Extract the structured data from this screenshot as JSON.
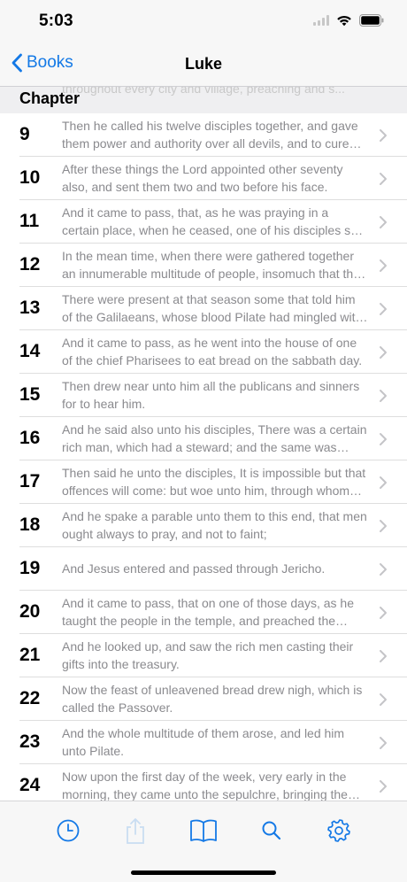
{
  "status_bar": {
    "time": "5:03"
  },
  "nav": {
    "back_label": "Books",
    "title": "Luke"
  },
  "section": {
    "header": "Chapter",
    "partial_text": "throughout every city and village, preaching and s..."
  },
  "colors": {
    "accent": "#1479e6",
    "subtitle": "#8a8a8e",
    "chevron": "#c4c4c7"
  },
  "chapters": [
    {
      "num": "9",
      "text": "Then he called his twelve disciples together, and gave them power and authority over all devils, and to cure diseases."
    },
    {
      "num": "10",
      "text": "After these things the Lord appointed other seventy also, and sent them two and two before his face."
    },
    {
      "num": "11",
      "text": "And it came to pass, that, as he was praying in a certain place, when he ceased, one of his disciples said unto him."
    },
    {
      "num": "12",
      "text": "In the mean time, when there were gathered together an innumerable multitude of people, insomuch that they trode one upon another."
    },
    {
      "num": "13",
      "text": "There were present at that season some that told him of the Galilaeans, whose blood Pilate had mingled with their sacrifices."
    },
    {
      "num": "14",
      "text": "And it came to pass, as he went into the house of one of the chief Pharisees to eat bread on the sabbath day."
    },
    {
      "num": "15",
      "text": "Then drew near unto him all the publicans and sinners for to hear him."
    },
    {
      "num": "16",
      "text": "And he said also unto his disciples, There was a certain rich man, which had a steward; and the same was accused."
    },
    {
      "num": "17",
      "text": "Then said he unto the disciples, It is impossible but that offences will come: but woe unto him, through whom they come!"
    },
    {
      "num": "18",
      "text": "And he spake a parable unto them to this end, that men ought always to pray, and not to faint;"
    },
    {
      "num": "19",
      "text": "And Jesus entered and passed through Jericho."
    },
    {
      "num": "20",
      "text": "And it came to pass, that on one of those days, as he taught the people in the temple, and preached the gospel."
    },
    {
      "num": "21",
      "text": "And he looked up, and saw the rich men casting their gifts into the treasury."
    },
    {
      "num": "22",
      "text": "Now the feast of unleavened bread drew nigh, which is called the Passover."
    },
    {
      "num": "23",
      "text": "And the whole multitude of them arose, and led him unto Pilate."
    },
    {
      "num": "24",
      "text": "Now upon the first day of the week, very early in the morning, they came unto the sepulchre, bringing the spices."
    }
  ],
  "tabs": [
    {
      "icon": "clock-icon",
      "name": "tab-history"
    },
    {
      "icon": "share-icon",
      "name": "tab-share"
    },
    {
      "icon": "book-icon",
      "name": "tab-books"
    },
    {
      "icon": "search-icon",
      "name": "tab-search"
    },
    {
      "icon": "gear-icon",
      "name": "tab-settings"
    }
  ]
}
